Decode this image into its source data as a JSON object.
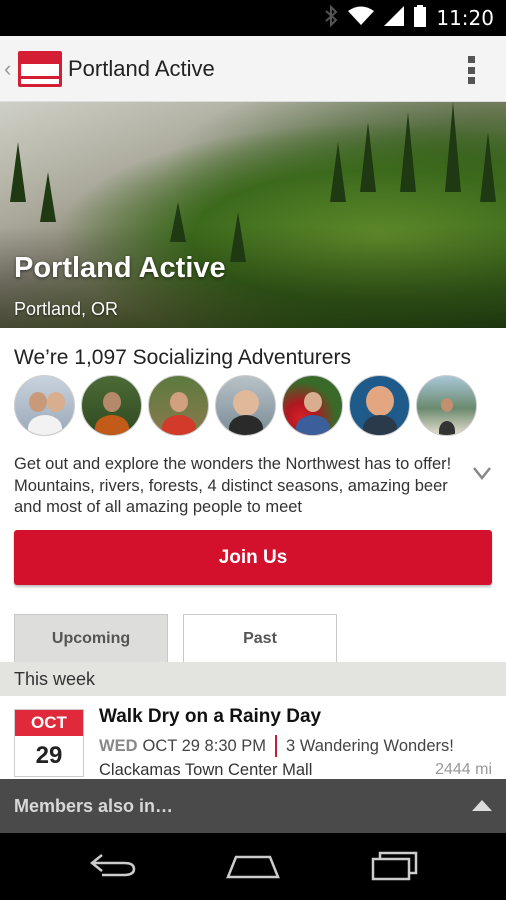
{
  "status_bar": {
    "time": "11:20"
  },
  "app_bar": {
    "title": "Portland Active"
  },
  "hero": {
    "title": "Portland Active",
    "location": "Portland, OR"
  },
  "members": {
    "heading": "We’re 1,097 Socializing Adventurers",
    "description": "Get out and explore the wonders the Northwest has to offer!  Mountains, rivers, forests, 4 distinct seasons, amazing beer and most of all amazing people to meet"
  },
  "join_button": {
    "label": "Join Us"
  },
  "tabs": [
    {
      "label": "Upcoming",
      "selected": true
    },
    {
      "label": "Past",
      "selected": false
    }
  ],
  "section": {
    "header": "This week"
  },
  "event": {
    "month": "OCT",
    "day": "29",
    "title": "Walk Dry on a Rainy Day",
    "weekday": "WED",
    "datetime": "OCT 29 8:30 PM",
    "attendees": "3 Wandering Wonders!",
    "venue": "Clackamas Town Center Mall",
    "distance": "2444 mi"
  },
  "members_also_in": {
    "label": "Members also in…"
  },
  "colors": {
    "accent": "#d4112c",
    "date_badge": "#e02a3c",
    "also_bar": "#4a4a4a"
  },
  "icons": [
    "bluetooth-icon",
    "wifi-icon",
    "signal-icon",
    "battery-icon",
    "overflow-menu-icon",
    "expand-chevron-icon",
    "back-nav-icon",
    "home-nav-icon",
    "recents-nav-icon"
  ]
}
